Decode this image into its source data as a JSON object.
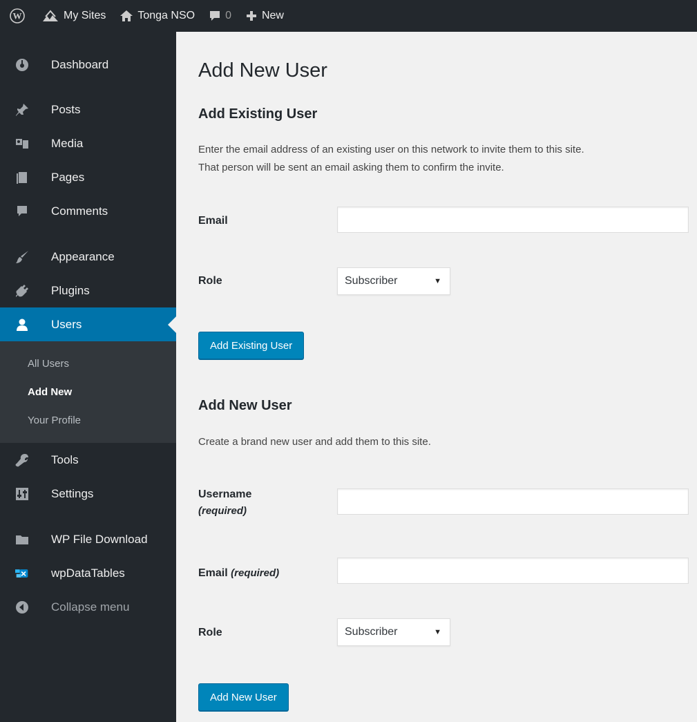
{
  "admin_bar": {
    "my_sites": "My Sites",
    "site_name": "Tonga NSO",
    "comments_count": "0",
    "new_label": "New",
    "icons": [
      "wordpress-logo-icon",
      "my-sites-icon",
      "home-icon",
      "comment-icon",
      "plus-icon"
    ]
  },
  "sidebar": {
    "items": [
      {
        "label": "Dashboard",
        "icon": "dashboard-icon"
      },
      {
        "label": "Posts",
        "icon": "pin-icon"
      },
      {
        "label": "Media",
        "icon": "media-icon"
      },
      {
        "label": "Pages",
        "icon": "pages-icon"
      },
      {
        "label": "Comments",
        "icon": "comment-icon"
      },
      {
        "label": "Appearance",
        "icon": "brush-icon"
      },
      {
        "label": "Plugins",
        "icon": "plug-icon"
      },
      {
        "label": "Users",
        "icon": "user-icon"
      },
      {
        "label": "Tools",
        "icon": "wrench-icon"
      },
      {
        "label": "Settings",
        "icon": "sliders-icon"
      },
      {
        "label": "WP File Download",
        "icon": "folder-icon"
      },
      {
        "label": "wpDataTables",
        "icon": "table-icon"
      }
    ],
    "submenu": [
      "All Users",
      "Add New",
      "Your Profile"
    ],
    "collapse": "Collapse menu"
  },
  "page": {
    "title": "Add New User",
    "existing": {
      "heading": "Add Existing User",
      "description_line1": "Enter the email address of an existing user on this network to invite them to this site.",
      "description_line2": "That person will be sent an email asking them to confirm the invite.",
      "email_label": "Email",
      "email_value": "",
      "role_label": "Role",
      "role_value": "Subscriber",
      "button": "Add Existing User"
    },
    "new_user": {
      "heading": "Add New User",
      "description": "Create a brand new user and add them to this site.",
      "username_label": "Username",
      "required": "(required)",
      "username_value": "",
      "email_label": "Email",
      "email_value": "",
      "role_label": "Role",
      "role_value": "Subscriber",
      "button": "Add New User"
    }
  },
  "colors": {
    "admin_bar_bg": "#23282d",
    "accent": "#0073aa",
    "button": "#0085ba",
    "content_bg": "#f1f1f1"
  }
}
